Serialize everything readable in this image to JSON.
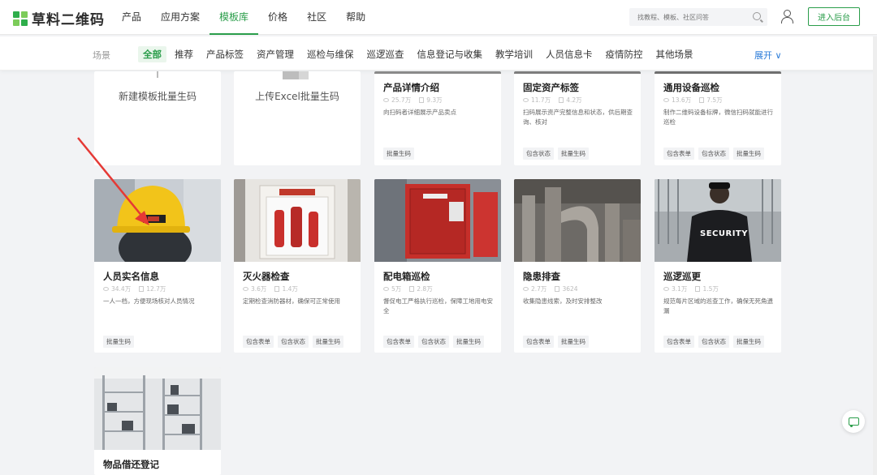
{
  "brand": {
    "name": "草料二维码"
  },
  "nav": [
    {
      "label": "产品",
      "active": false
    },
    {
      "label": "应用方案",
      "active": false
    },
    {
      "label": "模板库",
      "active": true
    },
    {
      "label": "价格",
      "active": false
    },
    {
      "label": "社区",
      "active": false
    },
    {
      "label": "帮助",
      "active": false
    }
  ],
  "search": {
    "placeholder": "找教程、模板、社区问答"
  },
  "header": {
    "admin_label": "进入后台"
  },
  "filters": {
    "label": "场景",
    "chips": [
      "全部",
      "推荐",
      "产品标签",
      "资产管理",
      "巡检与维保",
      "巡逻巡查",
      "信息登记与收集",
      "教学培训",
      "人员信息卡",
      "疫情防控",
      "其他场景"
    ],
    "active_index": 0,
    "expand_label": "展开"
  },
  "create_cards": [
    {
      "label": "新建模板批量生码"
    },
    {
      "label": "上传Excel批量生码"
    }
  ],
  "top_cards": [
    {
      "title": "产品详情介绍",
      "views": "25.7万",
      "uses": "9.3万",
      "desc": "向扫码者详细展示产品卖点",
      "tags": [
        "批量生码"
      ]
    },
    {
      "title": "固定资产标签",
      "views": "11.7万",
      "uses": "4.2万",
      "desc": "扫码展示资产完整信息和状态，供后期查询、核对",
      "tags": [
        "包含状态",
        "批量生码"
      ]
    },
    {
      "title": "通用设备巡检",
      "views": "13.6万",
      "uses": "7.5万",
      "desc": "制作二维码设备标牌，微信扫码就能进行巡检",
      "tags": [
        "包含表单",
        "包含状态",
        "批量生码"
      ]
    }
  ],
  "middle_cards": [
    {
      "title": "人员实名信息",
      "views": "34.4万",
      "uses": "12.7万",
      "desc": "一人一档，方便现场核对人员情况",
      "tags": [
        "批量生码"
      ],
      "image": "helmet-photo"
    },
    {
      "title": "灭火器检查",
      "views": "3.6万",
      "uses": "1.4万",
      "desc": "定期检查消防器材，确保可正常使用",
      "tags": [
        "包含表单",
        "包含状态",
        "批量生码"
      ],
      "image": "fire-extinguisher-photo"
    },
    {
      "title": "配电箱巡检",
      "views": "5万",
      "uses": "2.8万",
      "desc": "督促电工严格执行巡检，保障工地用电安全",
      "tags": [
        "包含表单",
        "包含状态",
        "批量生码"
      ],
      "image": "electric-box-photo"
    },
    {
      "title": "隐患排查",
      "views": "2.7万",
      "uses": "3624",
      "desc": "收集隐患线索，及时安排整改",
      "tags": [
        "包含表单",
        "批量生码"
      ],
      "image": "pipes-photo"
    },
    {
      "title": "巡逻巡更",
      "views": "3.1万",
      "uses": "1.5万",
      "desc": "规范每片区域的巡查工作，确保无死角遗漏",
      "tags": [
        "包含表单",
        "包含状态",
        "批量生码"
      ],
      "image": "security-guard-photo",
      "image_text": "SECURITY"
    }
  ],
  "bottom_cards": [
    {
      "title": "物品借还登记",
      "image": "warehouse-shelf-photo"
    }
  ],
  "colors": {
    "accent": "#2a9d4a",
    "link": "#2a7bd8",
    "arrow": "#e53935"
  }
}
